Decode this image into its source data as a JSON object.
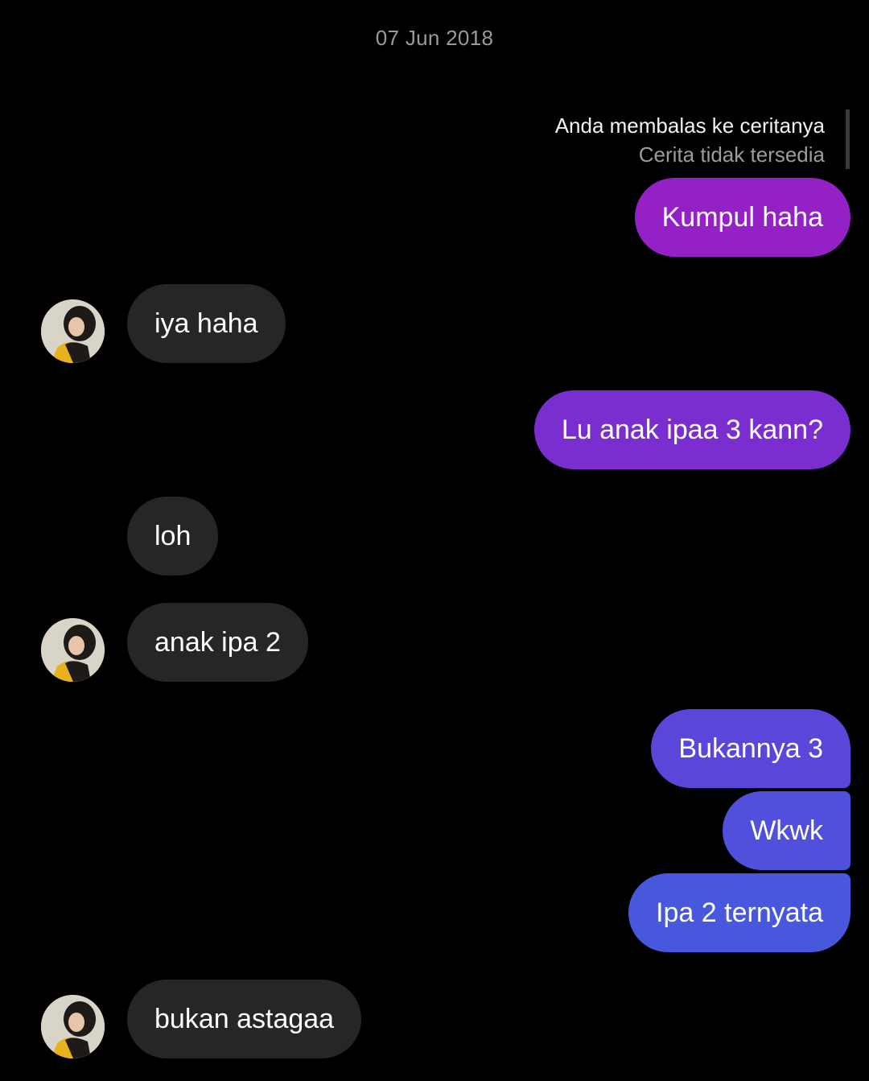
{
  "date_separator": "07 Jun 2018",
  "reply_context": {
    "title": "Anda membalas ke ceritanya",
    "subtitle": "Cerita tidak tersedia"
  },
  "messages": [
    {
      "side": "out",
      "text": "Kumpul haha",
      "color": "#9321c6"
    },
    {
      "side": "in",
      "text": "iya haha",
      "avatar": "profile-photo"
    },
    {
      "side": "out",
      "text": "Lu anak ipaa 3 kann?",
      "color": "#7b2ecf"
    },
    {
      "side": "in",
      "text": "loh"
    },
    {
      "side": "in",
      "text": "anak ipa 2",
      "avatar": "profile-photo"
    },
    {
      "side": "out",
      "text": "Bukannya 3",
      "color": "#5a46d9"
    },
    {
      "side": "out",
      "text": "Wkwk",
      "color": "#5150dc"
    },
    {
      "side": "out",
      "text": "Ipa 2 ternyata",
      "color": "#4858dd"
    },
    {
      "side": "in",
      "text": "bukan astagaa",
      "avatar": "profile-photo"
    }
  ],
  "colors": {
    "background": "#000000",
    "incoming_bubble": "#262626",
    "muted_text": "#9a9a9a"
  }
}
